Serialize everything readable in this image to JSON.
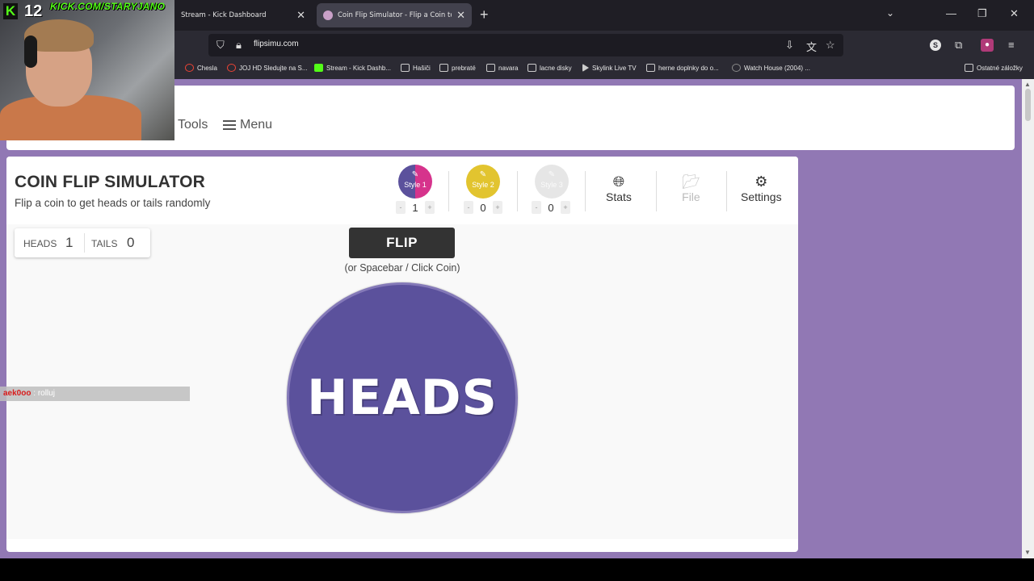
{
  "browser": {
    "tabs": [
      {
        "title": "Stream - Kick Dashboard",
        "active": false
      },
      {
        "title": "Coin Flip Simulator - Flip a Coin to Get H",
        "active": true
      }
    ],
    "url": "flipsimu.com",
    "bookmarks": [
      {
        "label": "Chesla",
        "icon": "google-icon"
      },
      {
        "label": "JOJ HD Sledujte na S...",
        "icon": "joj-icon"
      },
      {
        "label": "Stream - Kick Dashb...",
        "icon": "kick-icon"
      },
      {
        "label": "Hašiči",
        "icon": "folder-icon"
      },
      {
        "label": "prebraté",
        "icon": "folder-icon"
      },
      {
        "label": "navara",
        "icon": "folder-icon"
      },
      {
        "label": "lacne disky",
        "icon": "folder-icon"
      },
      {
        "label": "Skylink Live TV",
        "icon": "skylink-icon"
      },
      {
        "label": "herne doplnky do o...",
        "icon": "folder-icon"
      },
      {
        "label": "Watch House (2004) ...",
        "icon": "d-icon"
      },
      {
        "label": "Ostatné záložky",
        "icon": "folder-icon"
      }
    ]
  },
  "site_header": {
    "tools_label": "Tools",
    "menu_label": "Menu"
  },
  "app": {
    "title": "COIN FLIP SIMULATOR",
    "subtitle": "Flip a coin to get heads or tails randomly",
    "styles": [
      {
        "label": "Style 1",
        "count": "1",
        "color": "#d6338c",
        "color2": "#5b519c"
      },
      {
        "label": "Style 2",
        "count": "0",
        "color": "#e2c42f"
      },
      {
        "label": "Style 3",
        "count": "0",
        "color": "#e6e6e6"
      }
    ],
    "tools": {
      "stats_label": "Stats",
      "file_label": "File",
      "settings_label": "Settings"
    },
    "counter": {
      "heads_label": "HEADS",
      "heads_value": "1",
      "tails_label": "TAILS",
      "tails_value": "0"
    },
    "flip_label": "FLIP",
    "flip_hint": "(or Spacebar / Click Coin)",
    "coin_result": "HEADS",
    "coin_color": "#5b519c"
  },
  "overlay": {
    "viewer_count": "12",
    "stream_url": "KICK.COM/STARYJANO",
    "chat": {
      "user": "aek0oo",
      "separator": " : ",
      "message": "rolluj"
    }
  }
}
